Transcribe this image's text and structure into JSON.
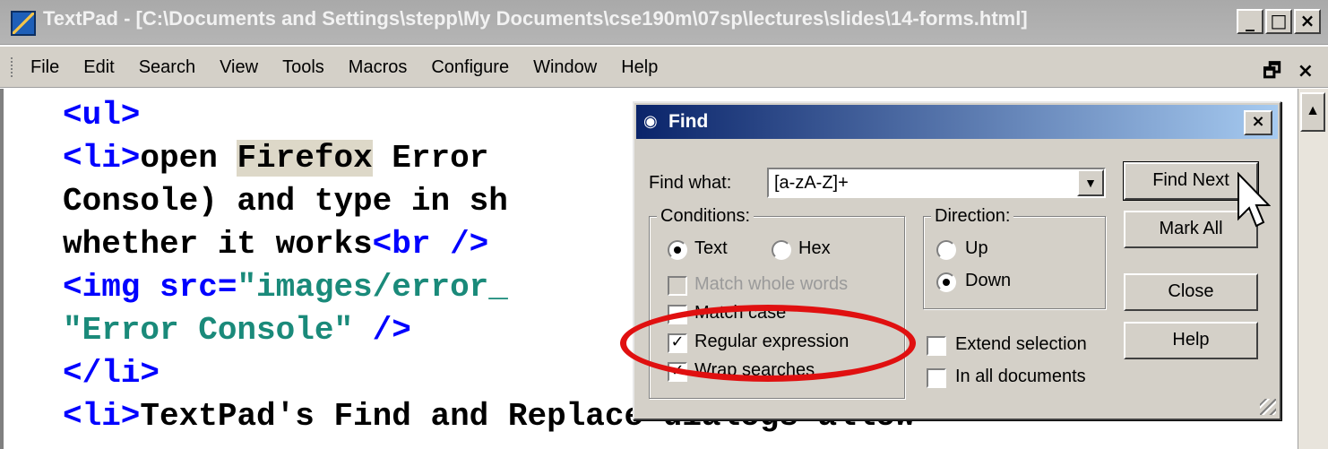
{
  "window": {
    "title": "TextPad - [C:\\Documents and Settings\\stepp\\My Documents\\cse190m\\07sp\\lectures\\slides\\14-forms.html]",
    "icon": "textpad-app-icon",
    "controls": {
      "minimize": "_",
      "maximize": "□",
      "close": "×"
    }
  },
  "menubar": {
    "items": [
      "File",
      "Edit",
      "Search",
      "View",
      "Tools",
      "Macros",
      "Configure",
      "Window",
      "Help"
    ],
    "right": {
      "restore": "🗗",
      "close": "×"
    }
  },
  "editor": {
    "lines": [
      {
        "parts": [
          {
            "t": "<ul>",
            "c": "tag"
          }
        ]
      },
      {
        "parts": [
          {
            "t": "<li>",
            "c": "tag"
          },
          {
            "t": "open "
          },
          {
            "t": "Firefox",
            "c": "hl"
          },
          {
            "t": " Error"
          }
        ]
      },
      {
        "parts": [
          {
            "t": "Console) and type in sh"
          }
        ]
      },
      {
        "parts": [
          {
            "t": "whether it works"
          },
          {
            "t": "<br />",
            "c": "tag"
          }
        ]
      },
      {
        "parts": [
          {
            "t": "<img src=",
            "c": "tag"
          },
          {
            "t": "\"images/error_",
            "c": "str"
          }
        ]
      },
      {
        "parts": [
          {
            "t": "\"Error Console\"",
            "c": "str"
          },
          {
            "t": " />",
            "c": "tag"
          }
        ]
      },
      {
        "parts": [
          {
            "t": "</li>",
            "c": "tag"
          }
        ]
      },
      {
        "parts": [
          {
            "t": "<li>",
            "c": "tag"
          },
          {
            "t": "TextPad's Find and Replace dialogs allow"
          }
        ]
      }
    ]
  },
  "find_dialog": {
    "title": "Find",
    "close": "×",
    "find_what_label": "Find what:",
    "find_what_value": "[a-zA-Z]+",
    "conditions": {
      "legend": "Conditions:",
      "text_label": "Text",
      "hex_label": "Hex",
      "selected": "Text",
      "match_whole_words": {
        "label": "Match whole words",
        "checked": false,
        "disabled": true
      },
      "match_case": {
        "label": "Match case",
        "checked": false
      },
      "regular_expression": {
        "label": "Regular expression",
        "checked": true
      },
      "wrap_searches": {
        "label": "Wrap searches",
        "checked": true
      }
    },
    "direction": {
      "legend": "Direction:",
      "up_label": "Up",
      "down_label": "Down",
      "selected": "Down"
    },
    "extend_selection": {
      "label": "Extend selection",
      "checked": false
    },
    "in_all_documents": {
      "label": "In all documents",
      "checked": false
    },
    "buttons": {
      "find_next": "Find Next",
      "mark_all": "Mark All",
      "close": "Close",
      "help": "Help"
    }
  },
  "annotation": {
    "highlight_color": "#e01010"
  },
  "colors": {
    "tag": "#0000ff",
    "string": "#1a8a7a",
    "highlight": "#ddd8c8",
    "dialog_bg": "#d4d0c8",
    "title_active": "#0a246a"
  }
}
